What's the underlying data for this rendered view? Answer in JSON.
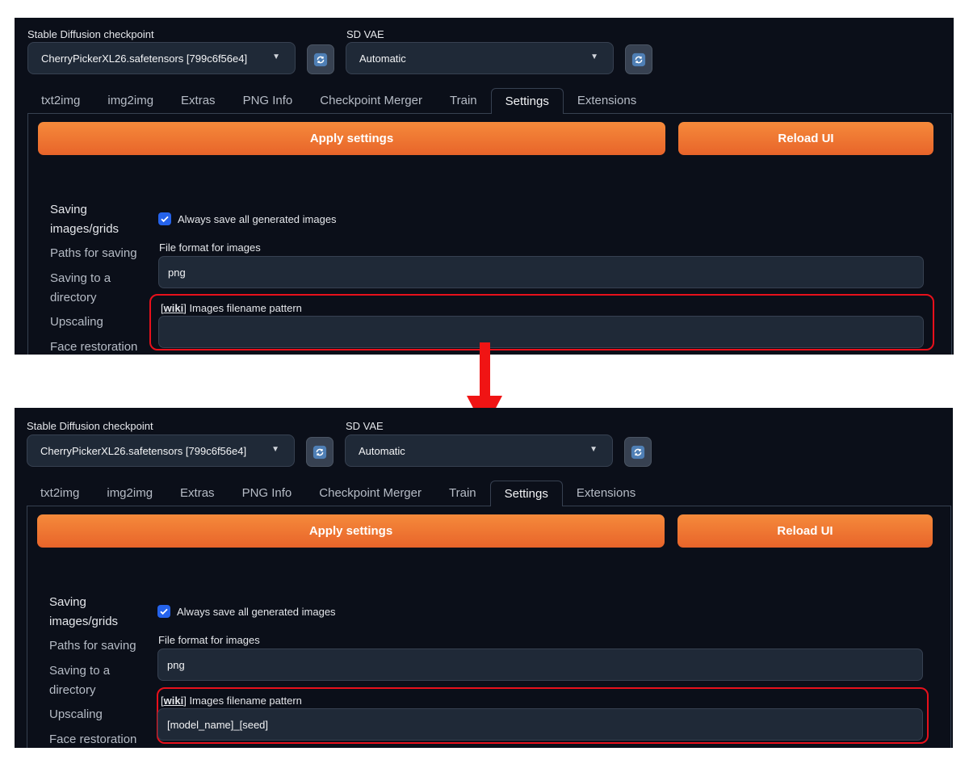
{
  "colors": {
    "background": "#0b0f19",
    "accent_orange": "#e8642a",
    "checkbox_blue": "#2563eb",
    "highlight_red": "#e8101b",
    "arrow_red": "#f01414"
  },
  "header": {
    "checkpoint_label": "Stable Diffusion checkpoint",
    "checkpoint_value": "CherryPickerXL26.safetensors [799c6f56e4]",
    "vae_label": "SD VAE",
    "vae_value": "Automatic",
    "refresh_icon": "refresh-icon",
    "dropdown_icon": "chevron-down-icon"
  },
  "tabs": [
    {
      "label": "txt2img"
    },
    {
      "label": "img2img"
    },
    {
      "label": "Extras"
    },
    {
      "label": "PNG Info"
    },
    {
      "label": "Checkpoint Merger"
    },
    {
      "label": "Train"
    },
    {
      "label": "Settings",
      "active": true
    },
    {
      "label": "Extensions"
    }
  ],
  "actions": {
    "apply_label": "Apply settings",
    "reload_label": "Reload UI"
  },
  "sidebar": {
    "items": [
      {
        "label": "Saving images/grids"
      },
      {
        "label": "Paths for saving"
      },
      {
        "label": "Saving to a directory"
      },
      {
        "label": "Upscaling"
      },
      {
        "label": "Face restoration"
      }
    ]
  },
  "settings": {
    "always_save_label": "Always save all generated images",
    "always_save_checked": true,
    "file_format_label": "File format for images",
    "file_format_value": "png",
    "wiki_link": "wiki",
    "filename_pattern_label": "Images filename pattern"
  },
  "panels": {
    "before": {
      "filename_pattern_value": ""
    },
    "after": {
      "filename_pattern_value": "[model_name]_[seed]"
    }
  },
  "arrow_icon": "arrow-down-icon"
}
